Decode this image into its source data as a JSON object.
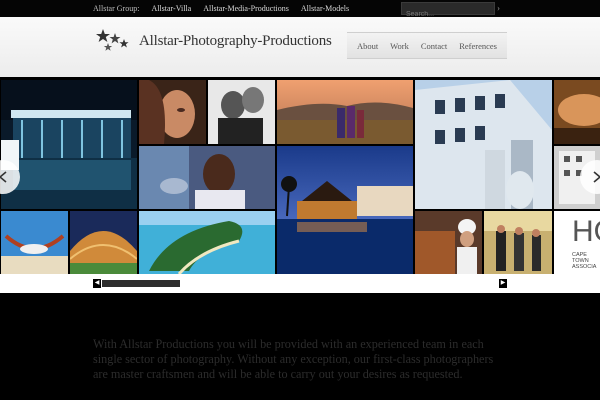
{
  "topbar": {
    "group_label": "Allstar Group:",
    "links": [
      "Allstar-Villa",
      "Allstar-Media-Productions",
      "Allstar-Models"
    ],
    "search_placeholder": "Search..."
  },
  "header": {
    "brand": "Allstar-Photography-Productions",
    "nav": [
      "About",
      "Work",
      "Contact",
      "References"
    ]
  },
  "gallery": {
    "tiles": [
      {
        "name": "architecture-night-tile",
        "alt": "Illuminated glass building at night"
      },
      {
        "name": "portrait-woman-tile",
        "alt": "Portrait of a woman"
      },
      {
        "name": "bw-couple-tile",
        "alt": "Black and white couple"
      },
      {
        "name": "savanna-maasai-tile",
        "alt": "Maasai people on savanna"
      },
      {
        "name": "modern-building-tile",
        "alt": "Modern building facade"
      },
      {
        "name": "spa-tile",
        "alt": "Spa massage"
      },
      {
        "name": "woman-smiling-tile",
        "alt": "Smiling woman"
      },
      {
        "name": "resort-night-tile",
        "alt": "Resort at dusk with palm trees"
      },
      {
        "name": "industrial-tanks-tile",
        "alt": "Industrial building"
      },
      {
        "name": "hammock-tile",
        "alt": "Person in hammock"
      },
      {
        "name": "stadium-tile",
        "alt": "Stadium interior"
      },
      {
        "name": "island-aerial-tile",
        "alt": "Aerial view of island"
      },
      {
        "name": "chef-tile",
        "alt": "Chef in kitchen"
      },
      {
        "name": "business-people-tile",
        "alt": "Business people walking"
      },
      {
        "name": "hotel-sign-tile",
        "alt": "Hotel sign"
      }
    ],
    "hotel_sign_text": [
      "HO",
      "CAPE",
      "TOWN",
      "ASSOCIA"
    ]
  },
  "intro": {
    "text": "With Allstar Productions you will be provided with an experienced team in each single sector of photography. Without any exception, our first-class photographers are master craftsmen and will be able to carry out your desires as requested."
  },
  "icons": {
    "prev": "chevron-left-icon",
    "next": "chevron-right-icon",
    "logo": "stars-logo-icon"
  },
  "colors": {
    "background": "#000000",
    "header_bg": "#f2f2f2",
    "brand_text": "#333333",
    "intro_text": "#2c2c2c"
  }
}
